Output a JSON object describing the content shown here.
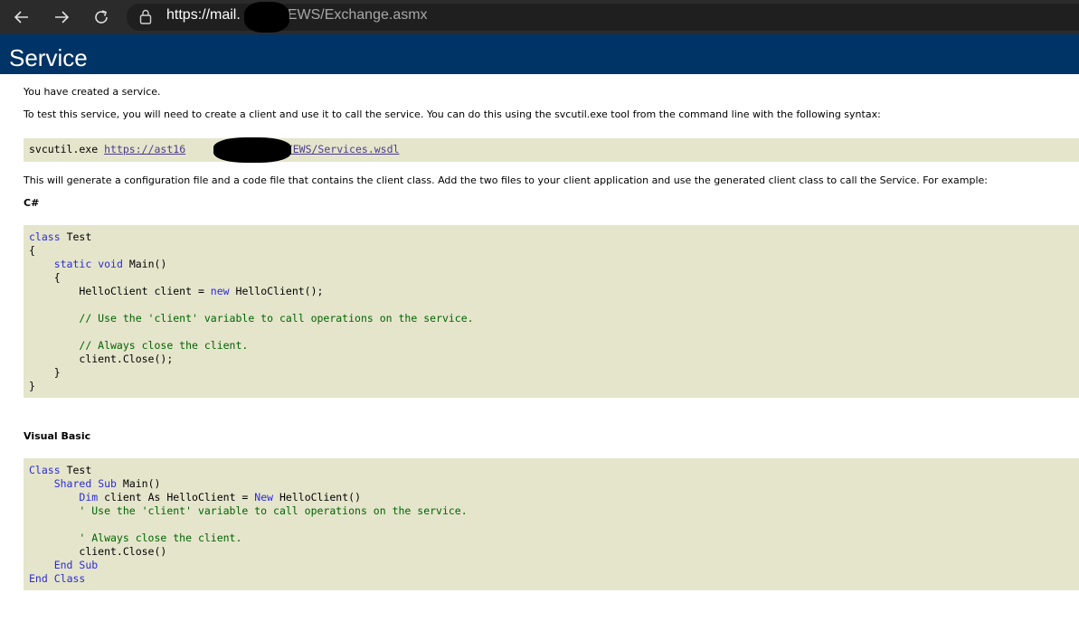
{
  "browser": {
    "url_prefix": "https://mail.",
    "url_suffix": "EWS/Exchange.asmx"
  },
  "page": {
    "title": "Service",
    "intro": "You have created a service.",
    "instructions": "To test this service, you will need to create a client and use it to call the service. You can do this using the svcutil.exe tool from the command line with the following syntax:",
    "svcutil": {
      "command": "svcutil.exe",
      "link_start": "https://ast16",
      "link_end": ":444/EWS/Services.wsdl"
    },
    "generate_text": "This will generate a configuration file and a code file that contains the client class. Add the two files to your client application and use the generated client class to call the Service. For example:",
    "csharp_heading": "C#",
    "vb_heading": "Visual Basic"
  },
  "csharp": {
    "kw_class": "class",
    "class_name": "Test",
    "brace_open": "{",
    "brace_close": "}",
    "kw_static": "static",
    "kw_void": "void",
    "main_sig": "Main()",
    "inner_open": "{",
    "inner_close": "}",
    "decl_start": "HelloClient client = ",
    "kw_new": "new",
    "decl_end": "HelloClient();",
    "comment_use": "// Use the 'client' variable to call operations on the service.",
    "comment_close": "// Always close the client.",
    "close_call": "client.Close();"
  },
  "vb": {
    "kw_class": "Class",
    "class_name": "Test",
    "kw_shared": "Shared",
    "kw_sub": "Sub",
    "main_sig": "Main()",
    "kw_dim": "Dim",
    "dim_middle": "client As HelloClient = ",
    "kw_new": "New",
    "dim_end": "HelloClient()",
    "comment_use": "' Use the 'client' variable to call operations on the service.",
    "comment_close": "' Always close the client.",
    "close_call": "client.Close()",
    "kw_end": "End",
    "kw_end_sub": "Sub",
    "kw_end2": "End",
    "kw_end_class": "Class"
  }
}
